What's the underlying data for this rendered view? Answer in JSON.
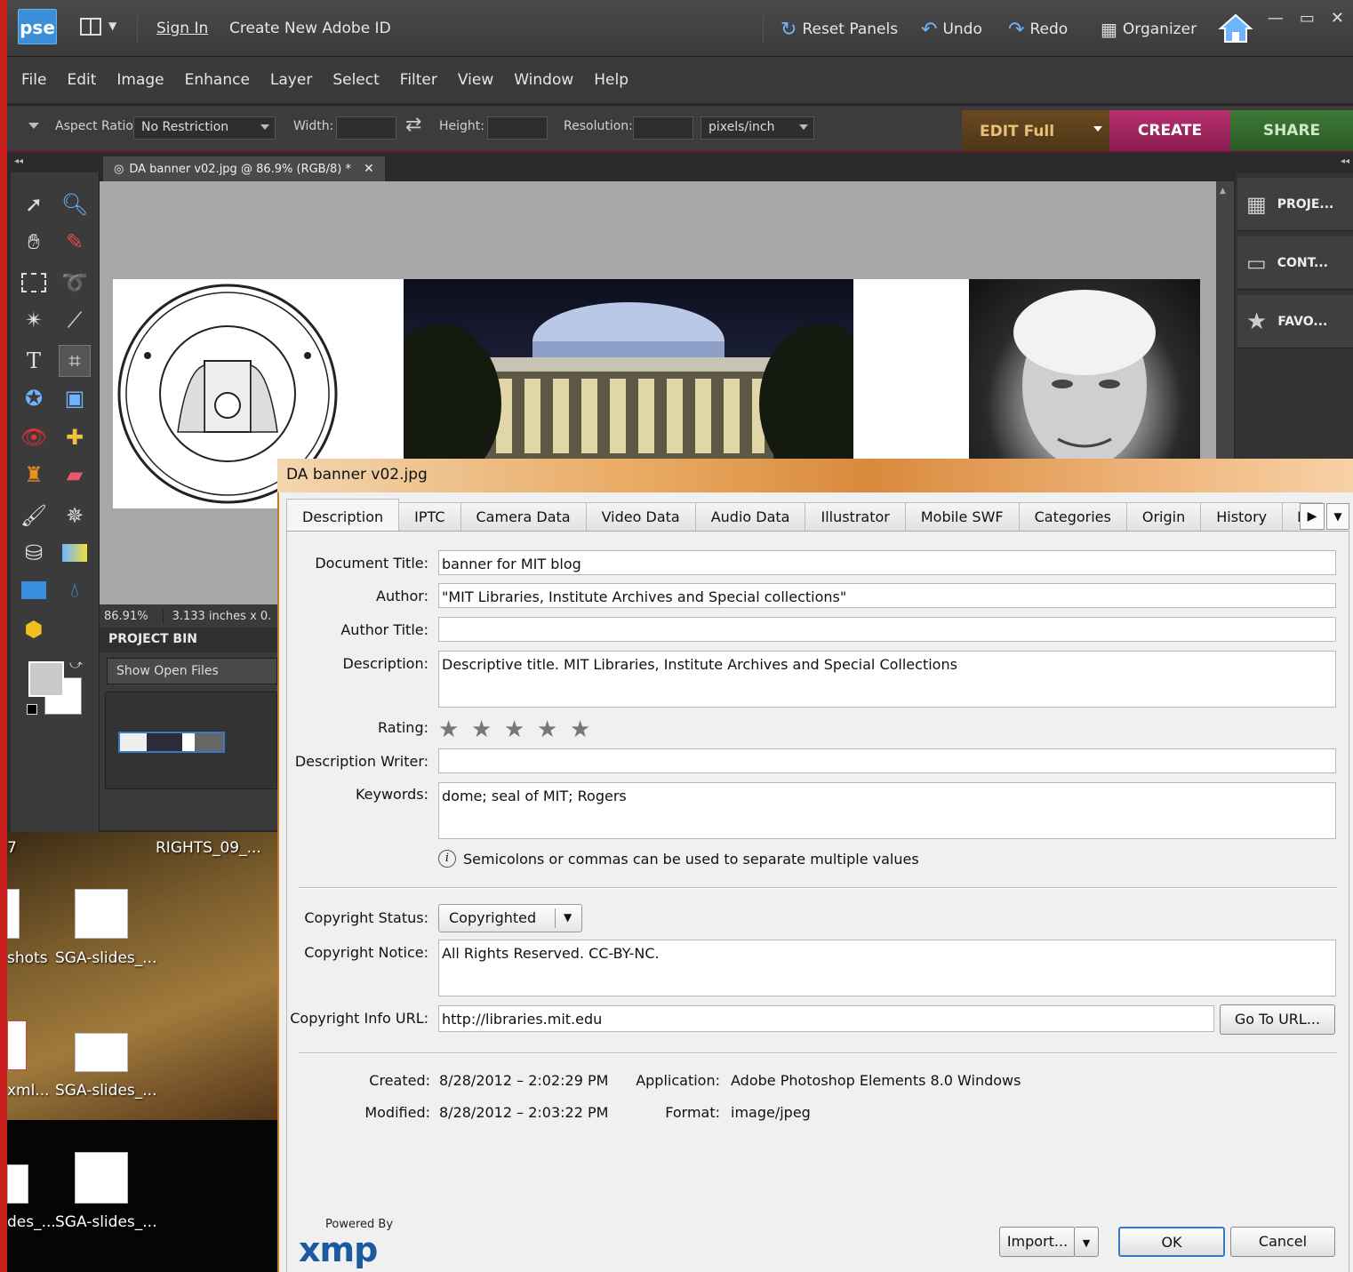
{
  "app": {
    "logo_text": "pse",
    "sign_in": "Sign In",
    "create_id": "Create New Adobe ID",
    "reset_panels": "Reset Panels",
    "undo": "Undo",
    "redo": "Redo",
    "organizer": "Organizer"
  },
  "menu": [
    "File",
    "Edit",
    "Image",
    "Enhance",
    "Layer",
    "Select",
    "Filter",
    "View",
    "Window",
    "Help"
  ],
  "options": {
    "aspect_label": "Aspect Ratio:",
    "aspect_value": "No Restriction",
    "width_label": "Width:",
    "height_label": "Height:",
    "resolution_label": "Resolution:",
    "units_value": "pixels/inch",
    "edit_full": "EDIT Full",
    "create": "CREATE",
    "share": "SHARE"
  },
  "document": {
    "tab_title": "DA banner v02.jpg @ 86.9% (RGB/8) *",
    "zoom": "86.91%",
    "size_info": "3.133 inches x 0."
  },
  "project_bin": {
    "title": "PROJECT BIN",
    "show": "Show Open Files"
  },
  "right_panel": [
    "PROJE...",
    "CONT...",
    "FAVO..."
  ],
  "desktop": {
    "label_rights": "RIGHTS_09_...",
    "label_7": "7",
    "labels": [
      "shots",
      "SGA-slides_...",
      "xml...",
      "SGA-slides_...",
      "des_...",
      "SGA-slides_..."
    ]
  },
  "dialog": {
    "title": "DA banner v02.jpg",
    "tabs": [
      "Description",
      "IPTC",
      "Camera Data",
      "Video Data",
      "Audio Data",
      "Illustrator",
      "Mobile SWF",
      "Categories",
      "Origin",
      "History",
      "DI"
    ],
    "active_tab": "Description",
    "fields": {
      "doc_title_label": "Document Title:",
      "doc_title": "banner for MIT blog",
      "author_label": "Author:",
      "author": "\"MIT Libraries, Institute Archives and Special collections\"",
      "author_title_label": "Author Title:",
      "author_title": "",
      "description_label": "Description:",
      "description": "Descriptive title. MIT Libraries, Institute Archives and Special Collections",
      "rating_label": "Rating:",
      "rating_value": 0,
      "rating_max": 5,
      "desc_writer_label": "Description Writer:",
      "desc_writer": "",
      "keywords_label": "Keywords:",
      "keywords": "dome; seal of MIT; Rogers",
      "hint": "Semicolons or commas can be used to separate multiple values",
      "copyright_status_label": "Copyright Status:",
      "copyright_status": "Copyrighted",
      "copyright_notice_label": "Copyright Notice:",
      "copyright_notice": "All Rights Reserved. CC-BY-NC.",
      "copyright_url_label": "Copyright Info URL:",
      "copyright_url": "http://libraries.mit.edu",
      "go_to_url": "Go To URL..."
    },
    "meta": {
      "created_label": "Created:",
      "created": "8/28/2012 – 2:02:29 PM",
      "modified_label": "Modified:",
      "modified": "8/28/2012 – 2:03:22 PM",
      "application_label": "Application:",
      "application": "Adobe Photoshop Elements 8.0 Windows",
      "format_label": "Format:",
      "format": "image/jpeg"
    },
    "powered_by": "Powered By",
    "xmp_logo": "xmp",
    "import_btn": "Import...",
    "ok_btn": "OK",
    "cancel_btn": "Cancel"
  },
  "colors": {
    "create_accent": "#b8306e",
    "share_accent": "#3e7a37",
    "edit_accent": "#6b4a22",
    "dialog_title_accent": "#d98a3c"
  }
}
